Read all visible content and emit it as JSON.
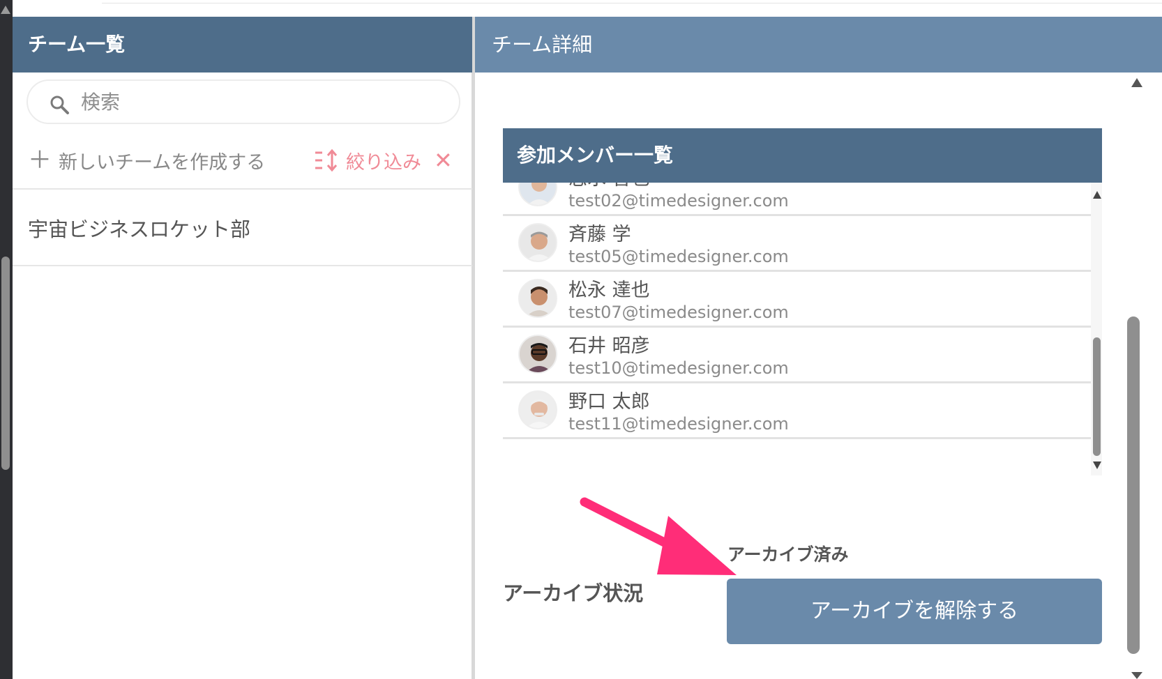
{
  "left_panel": {
    "header": "チーム一覧",
    "search_placeholder": "検索",
    "create_label": "新しいチームを作成する",
    "filter_label": "絞り込み",
    "teams": [
      {
        "name": "宇宙ビジネスロケット部"
      }
    ]
  },
  "right_panel": {
    "header": "チーム詳細",
    "members_header": "参加メンバー一覧",
    "members": [
      {
        "name": "志水 智也",
        "email": "test02@timedesigner.com"
      },
      {
        "name": "斉藤 学",
        "email": "test05@timedesigner.com"
      },
      {
        "name": "松永 達也",
        "email": "test07@timedesigner.com"
      },
      {
        "name": "石井 昭彦",
        "email": "test10@timedesigner.com"
      },
      {
        "name": "野口 太郎",
        "email": "test11@timedesigner.com"
      }
    ],
    "archive_status_label": "アーカイブ状況",
    "archive_status_value": "アーカイブ済み",
    "unarchive_button_label": "アーカイブを解除する"
  },
  "colors": {
    "header_dark": "#4e6d8a",
    "header_light": "#6a8aaa",
    "filter_accent": "#f08a96",
    "annotation_arrow": "#ff2d78"
  }
}
